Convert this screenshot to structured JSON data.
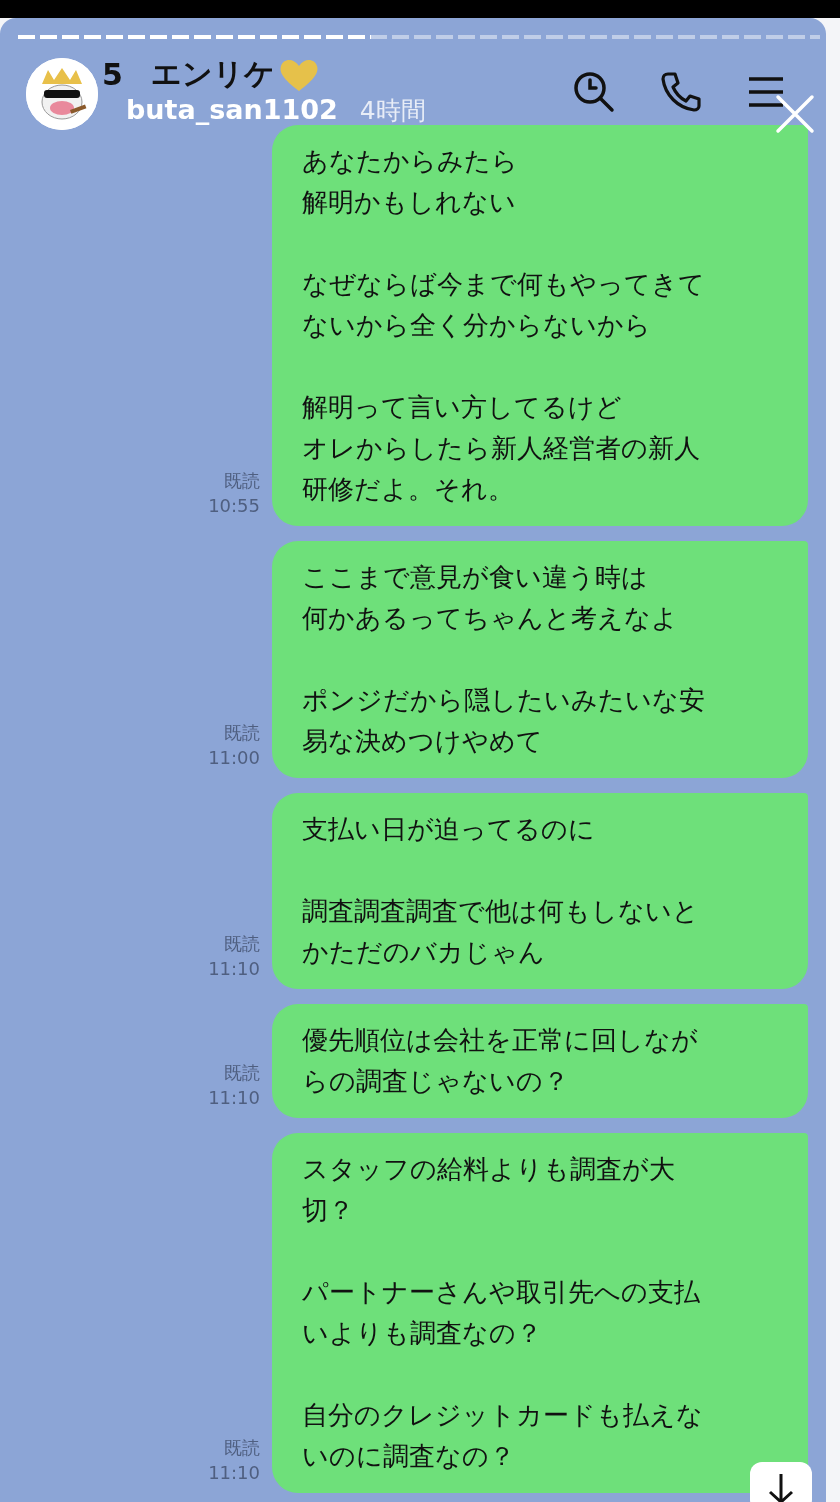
{
  "story": {
    "progress": {
      "level": 0.44
    },
    "user": "buta_san1102",
    "time": "4時間"
  },
  "chat_header": {
    "back_count": "5",
    "name": "エンリケ"
  },
  "messages": [
    {
      "paragraphs": [
        [
          "あなたからみたら",
          "解明かもしれない"
        ],
        [
          "なぜならば今まで何もやってきて",
          "ないから全く分からないから"
        ],
        [
          "解明って言い方してるけど",
          "オレからしたら新人経営者の新人",
          "研修だよ。それ。"
        ]
      ],
      "read": "既読",
      "time": "10:55"
    },
    {
      "paragraphs": [
        [
          "ここまで意見が食い違う時は",
          "何かあるってちゃんと考えなよ"
        ],
        [
          "ポンジだから隠したいみたいな安",
          "易な決めつけやめて"
        ]
      ],
      "read": "既読",
      "time": "11:00"
    },
    {
      "paragraphs": [
        [
          "支払い日が迫ってるのに"
        ],
        [
          "調査調査調査で他は何もしないと",
          "かただのバカじゃん"
        ]
      ],
      "read": "既読",
      "time": "11:10"
    },
    {
      "paragraphs": [
        [
          "優先順位は会社を正常に回しなが",
          "らの調査じゃないの？"
        ]
      ],
      "read": "既読",
      "time": "11:10"
    },
    {
      "paragraphs": [
        [
          "スタッフの給料よりも調査が大",
          "切？"
        ],
        [
          "パートナーさんや取引先への支払",
          "いよりも調査なの？"
        ],
        [
          "自分のクレジットカードも払えな",
          "いのに調査なの？"
        ]
      ],
      "read": "既読",
      "time": "11:10"
    }
  ]
}
